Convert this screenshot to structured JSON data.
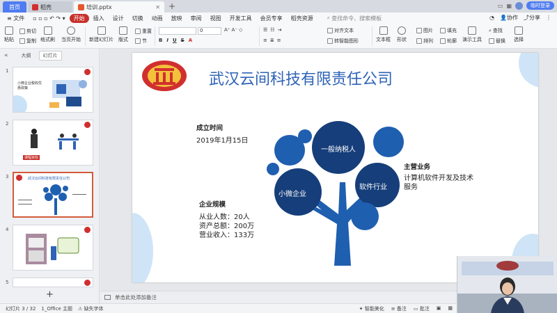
{
  "window": {
    "tabs": [
      {
        "label": "首页"
      },
      {
        "label": "稻壳"
      },
      {
        "label": "培训.pptx"
      }
    ],
    "trial_button": "临时登录"
  },
  "menu": {
    "file": "文件",
    "items": [
      "开始",
      "插入",
      "设计",
      "切换",
      "动画",
      "放映",
      "审阅",
      "视图",
      "开发工具",
      "会员专享",
      "稻壳资源"
    ],
    "active": "开始",
    "search_placeholder": "查找命令、搜索模板",
    "right": [
      "协作",
      "分享"
    ]
  },
  "ribbon": {
    "cut": "剪切",
    "paste": "粘贴",
    "copy": "复制",
    "format_painter": "格式刷",
    "start_from_current": "当页开始",
    "new_slide": "新建幻灯片",
    "layout": "版式",
    "section": "节",
    "reset": "重置",
    "font_size_value": "0",
    "align_text": "对齐文本",
    "convert_smartart": "转智能图形",
    "textbox": "文本框",
    "shape": "形状",
    "picture": "图片",
    "fill": "填充",
    "arrange": "排列",
    "outline": "轮廓",
    "find": "查找",
    "replace": "替换",
    "select": "选择",
    "presentation_tools": "演示工具"
  },
  "left_panel": {
    "tabs": [
      "大纲",
      "幻灯片"
    ],
    "active_tab": "幻灯片",
    "thumbnails": [
      {
        "num": "1",
        "text": "小微企业税收优惠政策"
      },
      {
        "num": "2",
        "text": "课程目标"
      },
      {
        "num": "3",
        "text": "武汉云间科技有限责任公司"
      },
      {
        "num": "4",
        "text": ""
      },
      {
        "num": "5",
        "text": ""
      }
    ],
    "selected": "3"
  },
  "slide": {
    "title": "武汉云间科技有限责任公司",
    "founding_label": "成立时间",
    "founding_date": "2019年1月15日",
    "scale_label": "企业规模",
    "scale_lines": [
      "从业人数：20人",
      "资产总额：200万",
      "营业收入：133万"
    ],
    "business_label": "主营业务",
    "business_text": "计算机软件开发及技术服务",
    "tree_labels": [
      "一般纳税人",
      "小微企业",
      "软件行业"
    ]
  },
  "notes": {
    "placeholder": "单击此处添加备注"
  },
  "status": {
    "slide_counter": "幻灯片 3 / 32",
    "theme": "1_Office 主题",
    "missing_font": "缺失字体",
    "smart_beautify": "智能美化",
    "notes": "备注",
    "comments": "批注"
  },
  "colors": {
    "accent_red": "#c8302b",
    "title_blue": "#2e63b6",
    "tree_blue": "#1f5fb0",
    "tree_dark": "#163e7a"
  }
}
